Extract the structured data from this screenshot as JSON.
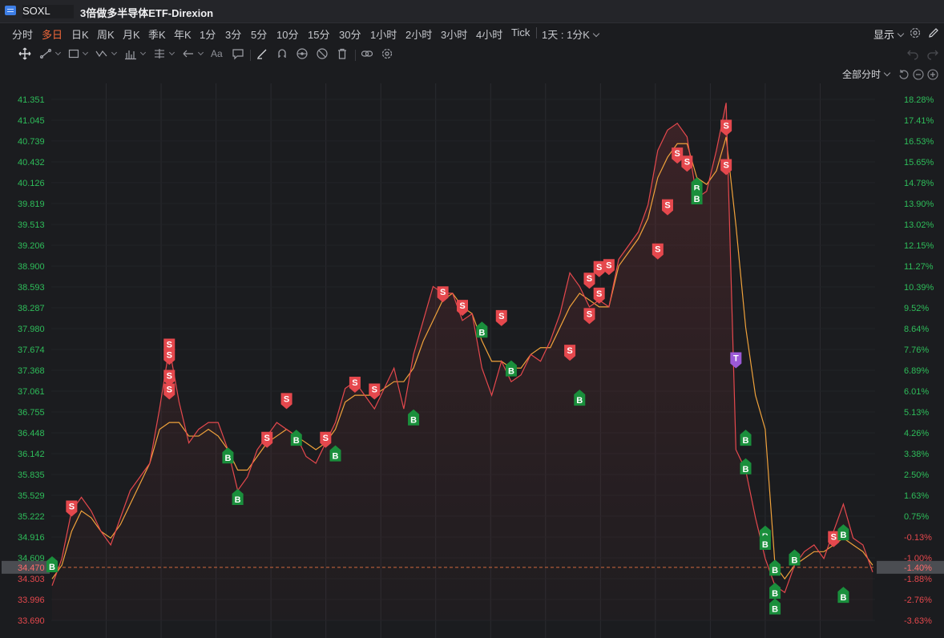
{
  "window": {
    "symbol": "SOXL",
    "security_name": "3倍做多半导体ETF-Direxion"
  },
  "periods": [
    {
      "label": "分时",
      "active": false
    },
    {
      "label": "多日",
      "active": true
    },
    {
      "label": "日K",
      "active": false
    },
    {
      "label": "周K",
      "active": false
    },
    {
      "label": "月K",
      "active": false
    },
    {
      "label": "季K",
      "active": false
    },
    {
      "label": "年K",
      "active": false
    },
    {
      "label": "1分",
      "active": false
    },
    {
      "label": "3分",
      "active": false
    },
    {
      "label": "5分",
      "active": false
    },
    {
      "label": "10分",
      "active": false
    },
    {
      "label": "15分",
      "active": false
    },
    {
      "label": "30分",
      "active": false
    },
    {
      "label": "1小时",
      "active": false
    },
    {
      "label": "2小时",
      "active": false
    },
    {
      "label": "3小时",
      "active": false
    },
    {
      "label": "4小时",
      "active": false
    },
    {
      "label": "Tick",
      "active": false
    }
  ],
  "interval_selector": "1天 : 1分K",
  "display_button": "显示",
  "toolbar": {
    "text_tool_label": "Aa",
    "icons": [
      "move-icon",
      "line-tool-icon",
      "rect-tool-icon",
      "wave-tool-icon",
      "bar-pattern-icon",
      "fib-tool-icon",
      "arrow-tool-icon",
      "text-tool-icon",
      "note-icon",
      "brush-icon",
      "magnet-icon",
      "eye-icon",
      "hide-icon",
      "trash-icon",
      "link-icon",
      "settings-icon"
    ]
  },
  "timeframe_selector": "全部分时",
  "colors": {
    "price_line": "#e5484d",
    "avg_line": "#f0a23b",
    "buy_marker": "#1a8f3c",
    "sell_marker": "#e5484d",
    "t_marker": "#9b59d6",
    "up_text": "#2ebd5a",
    "down_text": "#e5484d",
    "accent": "#f2683a"
  },
  "chart_data": {
    "type": "line",
    "y_price_ticks": [
      "41.351",
      "41.045",
      "40.739",
      "40.432",
      "40.126",
      "39.819",
      "39.513",
      "39.206",
      "38.900",
      "38.593",
      "38.287",
      "37.980",
      "37.674",
      "37.368",
      "37.061",
      "36.755",
      "36.448",
      "36.142",
      "35.835",
      "35.529",
      "35.222",
      "34.916",
      "34.609",
      "34.303",
      "33.996",
      "33.690"
    ],
    "y_pct_ticks": [
      "18.28%",
      "17.41%",
      "16.53%",
      "15.65%",
      "14.78%",
      "13.90%",
      "13.02%",
      "12.15%",
      "11.27%",
      "10.39%",
      "9.52%",
      "8.64%",
      "7.76%",
      "6.89%",
      "6.01%",
      "5.13%",
      "4.26%",
      "3.38%",
      "2.50%",
      "1.63%",
      "0.75%",
      "-0.13%",
      "-1.00%",
      "-1.88%",
      "-2.76%",
      "-3.63%"
    ],
    "ylim": [
      33.69,
      41.351
    ],
    "current_price": "34.470",
    "current_pct": "-1.40%",
    "days": 15,
    "series": [
      {
        "name": "price",
        "values": [
          34.2,
          34.6,
          35.3,
          35.5,
          35.3,
          35.0,
          34.8,
          35.2,
          35.6,
          35.8,
          36.0,
          36.8,
          37.7,
          36.9,
          36.3,
          36.5,
          36.6,
          36.6,
          36.2,
          35.6,
          35.8,
          36.2,
          36.4,
          36.6,
          36.5,
          36.4,
          36.1,
          36.0,
          36.3,
          36.6,
          37.1,
          37.2,
          37.0,
          36.8,
          37.1,
          37.4,
          36.8,
          37.6,
          38.1,
          38.6,
          38.5,
          38.5,
          38.1,
          38.2,
          37.4,
          37.0,
          37.5,
          37.2,
          37.3,
          37.6,
          37.5,
          37.8,
          38.2,
          38.8,
          38.6,
          38.3,
          38.4,
          38.3,
          39.0,
          39.2,
          39.4,
          39.8,
          40.6,
          40.9,
          41.0,
          40.8,
          39.9,
          40.0,
          40.6,
          41.3,
          36.2,
          35.9,
          35.2,
          34.6,
          34.2,
          34.1,
          34.5,
          34.7,
          34.8,
          34.6,
          35.0,
          35.4,
          34.9,
          34.8,
          34.4
        ]
      },
      {
        "name": "average",
        "values": [
          34.3,
          34.5,
          35.0,
          35.3,
          35.2,
          35.0,
          34.9,
          35.1,
          35.4,
          35.7,
          36.0,
          36.5,
          36.6,
          36.6,
          36.4,
          36.4,
          36.5,
          36.4,
          36.2,
          35.9,
          35.9,
          36.1,
          36.3,
          36.4,
          36.5,
          36.4,
          36.3,
          36.2,
          36.3,
          36.5,
          36.9,
          37.0,
          37.0,
          37.0,
          37.1,
          37.2,
          37.2,
          37.4,
          37.8,
          38.1,
          38.4,
          38.5,
          38.3,
          38.2,
          37.8,
          37.5,
          37.5,
          37.4,
          37.4,
          37.6,
          37.7,
          37.7,
          38.0,
          38.3,
          38.5,
          38.4,
          38.3,
          38.3,
          38.9,
          39.1,
          39.3,
          39.6,
          40.2,
          40.5,
          40.7,
          40.7,
          40.2,
          40.1,
          40.3,
          40.8,
          39.5,
          38.0,
          37.0,
          36.5,
          34.5,
          34.3,
          34.5,
          34.6,
          34.7,
          34.7,
          34.8,
          34.9,
          34.8,
          34.7,
          34.5
        ]
      }
    ],
    "markers": [
      {
        "type": "B",
        "label": "B",
        "i": 0,
        "price": 34.48
      },
      {
        "type": "S",
        "label": "S",
        "i": 2,
        "price": 35.37
      },
      {
        "type": "S",
        "label": "S",
        "i": 12,
        "price": 37.75
      },
      {
        "type": "S",
        "label": "S",
        "i": 12,
        "price": 37.6
      },
      {
        "type": "S",
        "label": "S",
        "i": 12,
        "price": 37.29
      },
      {
        "type": "S",
        "label": "S",
        "i": 12,
        "price": 37.09
      },
      {
        "type": "B",
        "label": "B",
        "i": 18,
        "price": 36.08
      },
      {
        "type": "B",
        "label": "B",
        "i": 19,
        "price": 35.47
      },
      {
        "type": "S",
        "label": "S",
        "i": 22,
        "price": 36.38
      },
      {
        "type": "S",
        "label": "S",
        "i": 24,
        "price": 36.95
      },
      {
        "type": "B",
        "label": "B",
        "i": 25,
        "price": 36.34
      },
      {
        "type": "S",
        "label": "S",
        "i": 28,
        "price": 36.38
      },
      {
        "type": "B",
        "label": "B",
        "i": 29,
        "price": 36.11
      },
      {
        "type": "S",
        "label": "S",
        "i": 31,
        "price": 37.19
      },
      {
        "type": "S",
        "label": "S",
        "i": 33,
        "price": 37.09
      },
      {
        "type": "B",
        "label": "B",
        "i": 37,
        "price": 36.64
      },
      {
        "type": "S",
        "label": "S",
        "i": 40,
        "price": 38.52
      },
      {
        "type": "S",
        "label": "S",
        "i": 42,
        "price": 38.32
      },
      {
        "type": "B",
        "label": "B",
        "i": 44,
        "price": 37.93
      },
      {
        "type": "S",
        "label": "S",
        "i": 46,
        "price": 38.17
      },
      {
        "type": "B",
        "label": "B",
        "i": 47,
        "price": 37.36
      },
      {
        "type": "S",
        "label": "S",
        "i": 53,
        "price": 37.66
      },
      {
        "type": "B",
        "label": "B",
        "i": 54,
        "price": 36.93
      },
      {
        "type": "S",
        "label": "S",
        "i": 55,
        "price": 38.2
      },
      {
        "type": "S",
        "label": "S",
        "i": 55,
        "price": 38.72
      },
      {
        "type": "S",
        "label": "S",
        "i": 56,
        "price": 38.5
      },
      {
        "type": "S",
        "label": "S",
        "i": 56,
        "price": 38.89
      },
      {
        "type": "S",
        "label": "S",
        "i": 57,
        "price": 38.92
      },
      {
        "type": "S",
        "label": "S",
        "i": 62,
        "price": 39.15
      },
      {
        "type": "S",
        "label": "S",
        "i": 63,
        "price": 39.8
      },
      {
        "type": "S",
        "label": "S",
        "i": 64,
        "price": 40.56
      },
      {
        "type": "S",
        "label": "S",
        "i": 65,
        "price": 40.44
      },
      {
        "type": "B",
        "label": "B",
        "i": 66,
        "price": 40.05
      },
      {
        "type": "B",
        "label": "B",
        "i": 66,
        "price": 39.89
      },
      {
        "type": "S",
        "label": "S",
        "i": 69,
        "price": 40.97
      },
      {
        "type": "S",
        "label": "S",
        "i": 69,
        "price": 40.39
      },
      {
        "type": "T",
        "label": "T",
        "i": 70,
        "price": 37.55
      },
      {
        "type": "B",
        "label": "B",
        "i": 71,
        "price": 36.34
      },
      {
        "type": "B",
        "label": "B",
        "i": 71,
        "price": 35.92
      },
      {
        "type": "B",
        "label": "B",
        "i": 73,
        "price": 34.93
      },
      {
        "type": "B",
        "label": "B",
        "i": 73,
        "price": 34.81
      },
      {
        "type": "B",
        "label": "B",
        "i": 74,
        "price": 34.43
      },
      {
        "type": "B",
        "label": "B",
        "i": 74,
        "price": 34.09
      },
      {
        "type": "B",
        "label": "B",
        "i": 74,
        "price": 33.86
      },
      {
        "type": "B",
        "label": "B",
        "i": 76,
        "price": 34.58
      },
      {
        "type": "S",
        "label": "S",
        "i": 80,
        "price": 34.92
      },
      {
        "type": "B",
        "label": "B",
        "i": 81,
        "price": 34.95
      },
      {
        "type": "B",
        "label": "B",
        "i": 81,
        "price": 34.03
      }
    ]
  }
}
